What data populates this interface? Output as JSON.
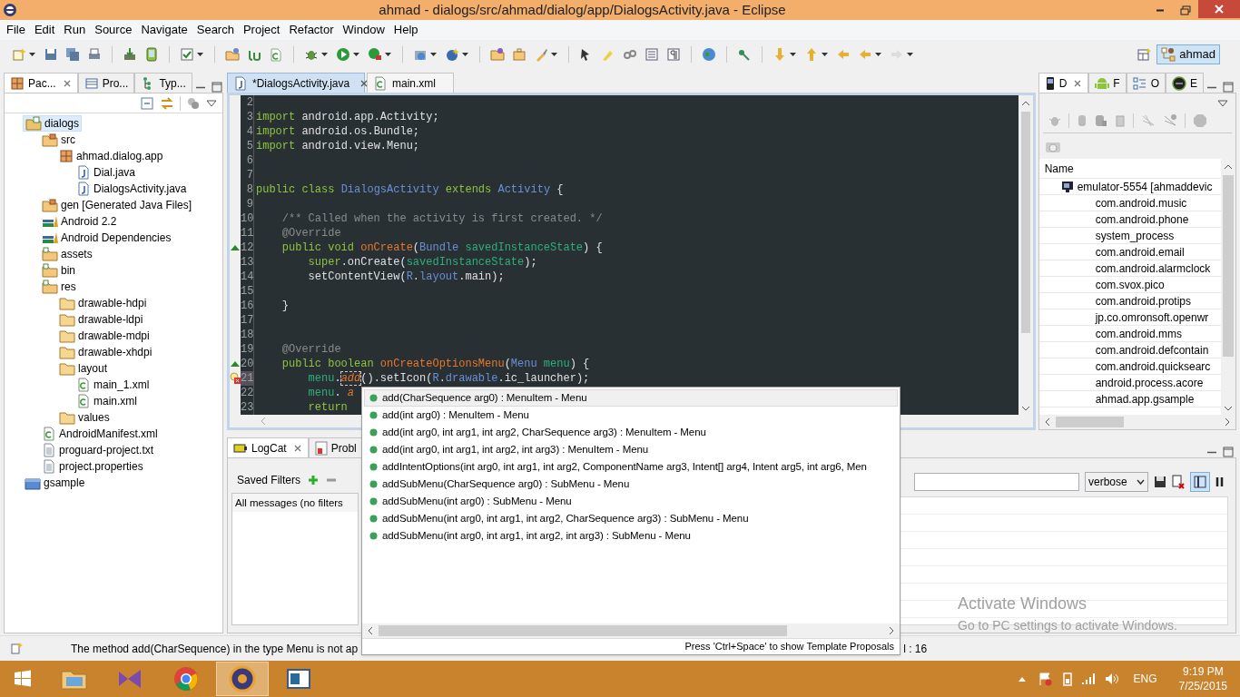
{
  "window": {
    "title": "ahmad - dialogs/src/ahmad/dialog/app/DialogsActivity.java - Eclipse"
  },
  "menu": [
    "File",
    "Edit",
    "Run",
    "Source",
    "Navigate",
    "Search",
    "Project",
    "Refactor",
    "Window",
    "Help"
  ],
  "perspective": {
    "label": "ahmad",
    "selected": true
  },
  "left_panel": {
    "tabs": [
      {
        "label": "Pac...",
        "selected": true,
        "kind": "package"
      },
      {
        "label": "Pro...",
        "selected": false,
        "kind": "table"
      },
      {
        "label": "Typ...",
        "selected": false,
        "kind": "hierarchy"
      }
    ],
    "tree": [
      {
        "label": "dialogs",
        "kind": "project",
        "selected": true,
        "children": [
          {
            "label": "src",
            "kind": "srcfolder",
            "selected": false,
            "children": [
              {
                "label": "ahmad.dialog.app",
                "kind": "package",
                "selected": false,
                "children": [
                  {
                    "label": "Dial.java",
                    "kind": "java",
                    "selected": false
                  },
                  {
                    "label": "DialogsActivity.java",
                    "kind": "java",
                    "selected": false
                  }
                ]
              }
            ]
          },
          {
            "label": "gen [Generated Java Files]",
            "kind": "srcfolder",
            "selected": false
          },
          {
            "label": "Android 2.2",
            "kind": "library",
            "selected": false
          },
          {
            "label": "Android Dependencies",
            "kind": "library",
            "selected": false
          },
          {
            "label": "assets",
            "kind": "resfolder",
            "selected": false
          },
          {
            "label": "bin",
            "kind": "resfolder",
            "selected": false
          },
          {
            "label": "res",
            "kind": "resfolder",
            "selected": false,
            "children": [
              {
                "label": "drawable-hdpi",
                "kind": "folder",
                "selected": false
              },
              {
                "label": "drawable-ldpi",
                "kind": "folder",
                "selected": false
              },
              {
                "label": "drawable-mdpi",
                "kind": "folder",
                "selected": false
              },
              {
                "label": "drawable-xhdpi",
                "kind": "folder",
                "selected": false
              },
              {
                "label": "layout",
                "kind": "folder",
                "selected": false,
                "children": [
                  {
                    "label": "main_1.xml",
                    "kind": "xml",
                    "selected": false
                  },
                  {
                    "label": "main.xml",
                    "kind": "xml",
                    "selected": false
                  }
                ]
              },
              {
                "label": "values",
                "kind": "folder",
                "selected": false
              }
            ]
          },
          {
            "label": "AndroidManifest.xml",
            "kind": "xml",
            "selected": false
          },
          {
            "label": "proguard-project.txt",
            "kind": "text",
            "selected": false
          },
          {
            "label": "project.properties",
            "kind": "text",
            "selected": false
          }
        ]
      },
      {
        "label": "gsample",
        "kind": "closedproject",
        "selected": false
      }
    ]
  },
  "editor": {
    "tabs": [
      {
        "label": "*DialogsActivity.java",
        "selected": true,
        "kind": "java"
      },
      {
        "label": "main.xml",
        "selected": false,
        "kind": "xml"
      }
    ],
    "lines": [
      {
        "number": "2",
        "override": false,
        "error": false
      },
      {
        "number": "3",
        "override": false,
        "error": false,
        "tokens": [
          {
            "text": "import ",
            "kind": "keyword"
          },
          {
            "text": "android.app.Activity;",
            "kind": "plain"
          }
        ]
      },
      {
        "number": "4",
        "override": false,
        "error": false,
        "tokens": [
          {
            "text": "import ",
            "kind": "keyword"
          },
          {
            "text": "android.os.Bundle;",
            "kind": "plain"
          }
        ]
      },
      {
        "number": "5",
        "override": false,
        "error": false,
        "tokens": [
          {
            "text": "import ",
            "kind": "keyword"
          },
          {
            "text": "android.view.Menu;",
            "kind": "plain"
          }
        ]
      },
      {
        "number": "6",
        "override": false,
        "error": false
      },
      {
        "number": "7",
        "override": false,
        "error": false
      },
      {
        "number": "8",
        "override": false,
        "error": false,
        "tokens": [
          {
            "text": "public class ",
            "kind": "keyword"
          },
          {
            "text": "DialogsActivity",
            "kind": "type"
          },
          {
            "text": " extends ",
            "kind": "keyword"
          },
          {
            "text": "Activity",
            "kind": "type"
          },
          {
            "text": " {",
            "kind": "plain"
          }
        ]
      },
      {
        "number": "9",
        "override": false,
        "error": false
      },
      {
        "number": "10",
        "override": false,
        "error": false,
        "tokens": [
          {
            "text": "    /** Called when the activity is first created. */",
            "kind": "comment"
          }
        ]
      },
      {
        "number": "11",
        "override": false,
        "error": false,
        "tokens": [
          {
            "text": "    @Override",
            "kind": "comment"
          }
        ]
      },
      {
        "number": "12",
        "override": true,
        "error": false,
        "tokens": [
          {
            "text": "    public void ",
            "kind": "keyword"
          },
          {
            "text": "onCreate",
            "kind": "method"
          },
          {
            "text": "(",
            "kind": "plain"
          },
          {
            "text": "Bundle",
            "kind": "type"
          },
          {
            "text": " savedInstanceState",
            "kind": "param"
          },
          {
            "text": ") {",
            "kind": "plain"
          }
        ]
      },
      {
        "number": "13",
        "override": false,
        "error": false,
        "tokens": [
          {
            "text": "        super",
            "kind": "keyword"
          },
          {
            "text": ".onCreate(",
            "kind": "plain"
          },
          {
            "text": "savedInstanceState",
            "kind": "param"
          },
          {
            "text": ");",
            "kind": "plain"
          }
        ]
      },
      {
        "number": "14",
        "override": false,
        "error": false,
        "tokens": [
          {
            "text": "        setContentView(",
            "kind": "plain"
          },
          {
            "text": "R",
            "kind": "type"
          },
          {
            "text": ".",
            "kind": "plain"
          },
          {
            "text": "layout",
            "kind": "type"
          },
          {
            "text": ".main);",
            "kind": "plain"
          }
        ]
      },
      {
        "number": "15",
        "override": false,
        "error": false
      },
      {
        "number": "16",
        "override": false,
        "error": false,
        "tokens": [
          {
            "text": "    }",
            "kind": "plain"
          }
        ]
      },
      {
        "number": "17",
        "override": false,
        "error": false
      },
      {
        "number": "18",
        "override": false,
        "error": false
      },
      {
        "number": "19",
        "override": false,
        "error": false,
        "tokens": [
          {
            "text": "    @Override",
            "kind": "comment"
          }
        ]
      },
      {
        "number": "20",
        "override": true,
        "error": false,
        "tokens": [
          {
            "text": "    public boolean ",
            "kind": "keyword"
          },
          {
            "text": "onCreateOptionsMenu",
            "kind": "method"
          },
          {
            "text": "(",
            "kind": "plain"
          },
          {
            "text": "Menu",
            "kind": "type"
          },
          {
            "text": " menu",
            "kind": "param"
          },
          {
            "text": ") {",
            "kind": "plain"
          }
        ]
      },
      {
        "number": "21",
        "override": false,
        "error": true,
        "tokens": [
          {
            "text": "        menu",
            "kind": "param"
          },
          {
            "text": ".",
            "kind": "plain"
          },
          {
            "text": "add",
            "kind": "error"
          },
          {
            "text": "().setIcon(",
            "kind": "plain"
          },
          {
            "text": "R",
            "kind": "type"
          },
          {
            "text": ".",
            "kind": "plain"
          },
          {
            "text": "drawable",
            "kind": "type"
          },
          {
            "text": ".ic_launcher);",
            "kind": "plain"
          }
        ]
      },
      {
        "number": "22",
        "override": false,
        "error": false,
        "tokens": [
          {
            "text": "        menu",
            "kind": "param"
          },
          {
            "text": ". ",
            "kind": "plain"
          },
          {
            "text": "a",
            "kind": "errorcut"
          }
        ]
      },
      {
        "number": "23",
        "override": false,
        "error": false,
        "tokens": [
          {
            "text": "        return",
            "kind": "keyword"
          }
        ]
      }
    ]
  },
  "completion": {
    "items": [
      {
        "text": "add(CharSequence arg0) : MenuItem - Menu",
        "selected": true
      },
      {
        "text": "add(int arg0) : MenuItem - Menu",
        "selected": false
      },
      {
        "text": "add(int arg0, int arg1, int arg2, CharSequence arg3) : MenuItem - Menu",
        "selected": false
      },
      {
        "text": "add(int arg0, int arg1, int arg2, int arg3) : MenuItem - Menu",
        "selected": false
      },
      {
        "text": "addIntentOptions(int arg0, int arg1, int arg2, ComponentName arg3, Intent[] arg4, Intent arg5, int arg6, Men",
        "selected": false
      },
      {
        "text": "addSubMenu(CharSequence arg0) : SubMenu - Menu",
        "selected": false
      },
      {
        "text": "addSubMenu(int arg0) : SubMenu - Menu",
        "selected": false
      },
      {
        "text": "addSubMenu(int arg0, int arg1, int arg2, CharSequence arg3) : SubMenu - Menu",
        "selected": false
      },
      {
        "text": "addSubMenu(int arg0, int arg1, int arg2, int arg3) : SubMenu - Menu",
        "selected": false
      }
    ],
    "footer": "Press 'Ctrl+Space' to show Template Proposals"
  },
  "right_panel": {
    "tabs": [
      {
        "label": "D",
        "selected": true,
        "kind": "phone"
      },
      {
        "label": "F",
        "selected": false,
        "kind": "android"
      },
      {
        "label": "O",
        "selected": false,
        "kind": "outline"
      },
      {
        "label": "E",
        "selected": false,
        "kind": "emulator"
      }
    ],
    "column": "Name",
    "device": "emulator-5554 [ahmaddevic",
    "processes": [
      "com.android.music",
      "com.android.phone",
      "system_process",
      "com.android.email",
      "com.android.alarmclock",
      "com.svox.pico",
      "com.android.protips",
      "jp.co.omronsoft.openwr",
      "com.android.mms",
      "com.android.defcontain",
      "com.android.quicksearc",
      "android.process.acore",
      "ahmad.app.gsample"
    ]
  },
  "bottom_panel": {
    "tabs": [
      {
        "label": "LogCat",
        "selected": true
      },
      {
        "label": "Probl",
        "selected": false
      }
    ],
    "saved_filters": "Saved Filters",
    "filters": [
      {
        "label": "All messages (no filters",
        "selected": false
      }
    ],
    "level": "verbose"
  },
  "status_bar": {
    "message": "The method add(CharSequence) in the type Menu is not ap",
    "position": "l : 16"
  },
  "activation": {
    "title": "Activate Windows",
    "subtitle": "Go to PC settings to activate Windows."
  },
  "taskbar": {
    "apps": [
      {
        "kind": "explorer",
        "selected": false
      },
      {
        "kind": "studio",
        "selected": false
      },
      {
        "kind": "chrome",
        "selected": false
      },
      {
        "kind": "eclipse",
        "selected": true
      },
      {
        "kind": "window",
        "selected": false
      }
    ],
    "language": "ENG",
    "time": "9:19 PM",
    "date": "7/25/2015"
  }
}
